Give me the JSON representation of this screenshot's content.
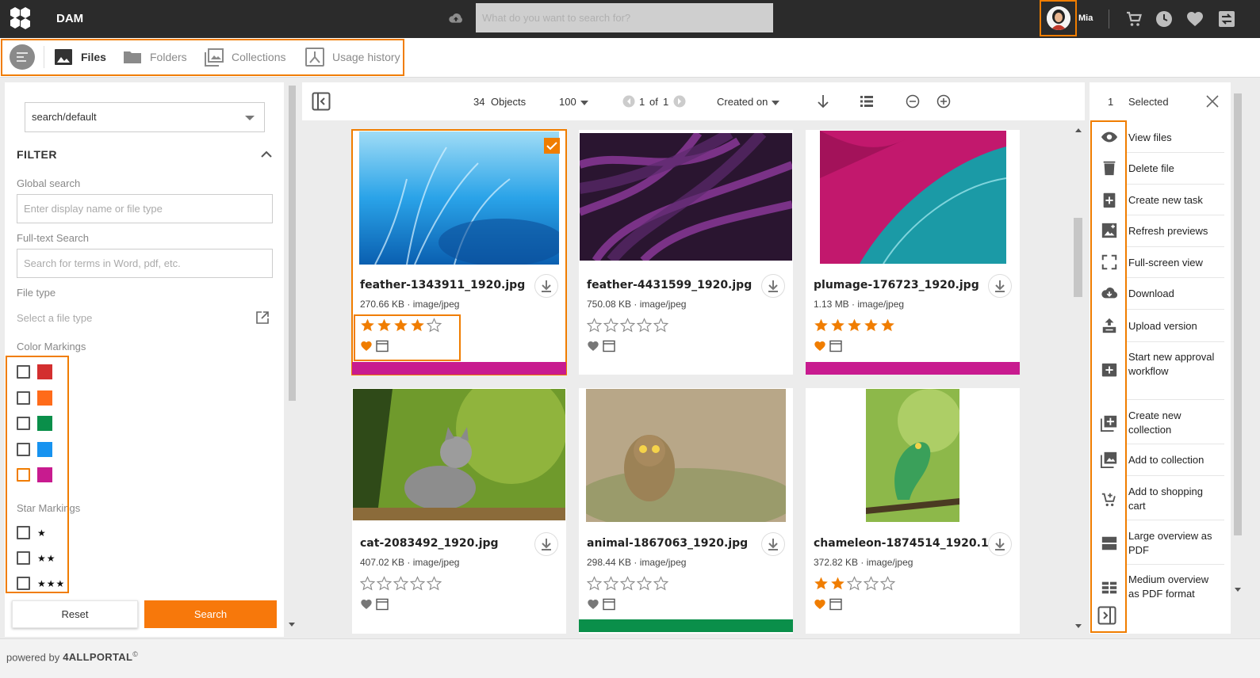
{
  "topbar": {
    "app_name": "DAM",
    "search_placeholder": "What do you want to search for?",
    "user_name": "Mia"
  },
  "tabs": [
    {
      "label": "Files",
      "icon": "image-icon",
      "active": true
    },
    {
      "label": "Folders",
      "icon": "folder-icon",
      "active": false
    },
    {
      "label": "Collections",
      "icon": "collections-icon",
      "active": false
    },
    {
      "label": "Usage history",
      "icon": "usage-history-icon",
      "active": false
    }
  ],
  "filter": {
    "preset_value": "search/default",
    "title": "FILTER",
    "global_search_label": "Global search",
    "global_search_placeholder": "Enter display name or file type",
    "fulltext_label": "Full-text Search",
    "fulltext_placeholder": "Search for terms in Word, pdf, etc.",
    "filetype_label": "File type",
    "filetype_placeholder": "Select a file type",
    "color_markings_label": "Color Markings",
    "color_markings": [
      "#d32f2f",
      "#ff6b1a",
      "#0a8f4a",
      "#1793f0",
      "#c81b8f"
    ],
    "star_markings_label": "Star Markings",
    "star_markings": [
      "★",
      "★★",
      "★★★"
    ],
    "reset_label": "Reset",
    "search_label": "Search"
  },
  "toolbar": {
    "object_count": "34",
    "objects_label": "Objects",
    "page_size": "100",
    "page_current": "1",
    "page_of": "of",
    "page_total": "1",
    "sort_label": "Created on"
  },
  "files": [
    {
      "name": "feather-1343911_1920.jpg",
      "size": "270.66 KB",
      "type": "image/jpeg",
      "rating": 4,
      "favorite": true,
      "color": "#c81b8f",
      "selected": true
    },
    {
      "name": "feather-4431599_1920.jpg",
      "size": "750.08 KB",
      "type": "image/jpeg",
      "rating": 0,
      "favorite": false,
      "color": "",
      "selected": false
    },
    {
      "name": "plumage-176723_1920.jpg",
      "size": "1.13 MB",
      "type": "image/jpeg",
      "rating": 5,
      "favorite": true,
      "color": "#c81b8f",
      "selected": false
    },
    {
      "name": "cat-2083492_1920.jpg",
      "size": "407.02 KB",
      "type": "image/jpeg",
      "rating": 0,
      "favorite": false,
      "color": "",
      "selected": false
    },
    {
      "name": "animal-1867063_1920.jpg",
      "size": "298.44 KB",
      "type": "image/jpeg",
      "rating": 0,
      "favorite": false,
      "color": "#0a8f4a",
      "selected": false
    },
    {
      "name": "chameleon-1874514_1920.1...",
      "size": "372.82 KB",
      "type": "image/jpeg",
      "rating": 2,
      "favorite": true,
      "color": "",
      "selected": false
    }
  ],
  "selection": {
    "count": "1",
    "label": "Selected"
  },
  "actions": [
    {
      "label": "View files",
      "icon": "eye-icon"
    },
    {
      "label": "Delete file",
      "icon": "trash-icon"
    },
    {
      "label": "Create new task",
      "icon": "clipboard-plus-icon"
    },
    {
      "label": "Refresh previews",
      "icon": "refresh-preview-icon"
    },
    {
      "label": "Full-screen view",
      "icon": "fullscreen-icon"
    },
    {
      "label": "Download",
      "icon": "cloud-download-icon"
    },
    {
      "label": "Upload version",
      "icon": "upload-version-icon"
    },
    {
      "label": "Start new approval workflow",
      "icon": "approval-plus-icon"
    },
    {
      "label": "Create new collection",
      "icon": "collection-plus-icon"
    },
    {
      "label": "Add to collection",
      "icon": "add-collection-icon"
    },
    {
      "label": "Add to shopping cart",
      "icon": "cart-plus-icon"
    },
    {
      "label": "Large overview as PDF",
      "icon": "large-overview-icon"
    },
    {
      "label": "Medium overview as PDF format",
      "icon": "medium-overview-icon"
    }
  ],
  "footer": {
    "powered_by": "powered by",
    "brand": "4ALLPORTAL",
    "copyright": "©"
  },
  "colors": {
    "accent": "#f07d00",
    "topbar": "#2b2b2b",
    "magenta": "#c81b8f",
    "green": "#0a8f4a"
  }
}
